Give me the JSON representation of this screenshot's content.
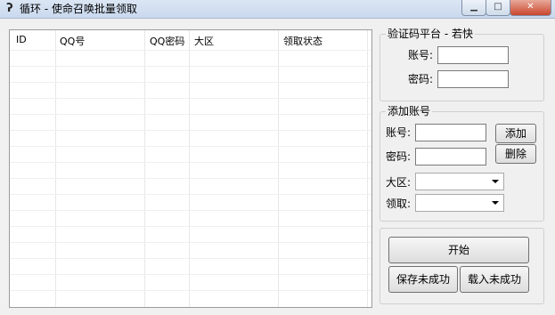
{
  "window": {
    "title": "循环 - 使命召唤批量领取",
    "icon": "app-icon"
  },
  "table": {
    "columns": [
      "ID",
      "QQ号",
      "QQ密码",
      "大区",
      "领取状态"
    ],
    "rows": []
  },
  "captcha": {
    "title": "验证码平台 - 若快",
    "account_label": "账号:",
    "account_value": "",
    "password_label": "密码:",
    "password_value": ""
  },
  "add_account": {
    "title": "添加账号",
    "account_label": "账号:",
    "account_value": "",
    "password_label": "密码:",
    "password_value": "",
    "add_button": "添加",
    "delete_button": "删除",
    "region_label": "大区:",
    "region_value": "",
    "claim_label": "领取:",
    "claim_value": ""
  },
  "actions": {
    "start": "开始",
    "save_failed": "保存未成功",
    "load_failed": "载入未成功"
  }
}
